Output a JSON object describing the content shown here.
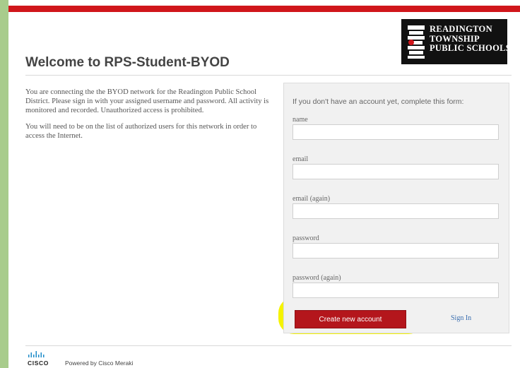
{
  "header": {
    "title": "Welcome to RPS-Student-BYOD",
    "logo_lines": [
      "READINGTON",
      "TOWNSHIP",
      "PUBLIC SCHOOLS"
    ]
  },
  "intro": {
    "paragraph1": "You are connecting the the BYOD network for the Readington Public School District. Please sign in with your assigned username and password. All activity is monitored and recorded. Unauthorized access is prohibited.",
    "paragraph2": "You will need to be on the list of authorized users for this network in order to access the Internet."
  },
  "form": {
    "heading": "If you don't have an account yet, complete this form:",
    "fields": [
      {
        "label": "name",
        "value": ""
      },
      {
        "label": "email",
        "value": ""
      },
      {
        "label": "email (again)",
        "value": ""
      },
      {
        "label": "password",
        "value": ""
      },
      {
        "label": "password (again)",
        "value": ""
      }
    ],
    "create_button": "Create new account",
    "signin_link": "Sign In"
  },
  "footer": {
    "brand": "CISCO",
    "powered_by": "Powered by Cisco Meraki"
  },
  "colors": {
    "top_bar": "#d0161b",
    "button": "#b4161c",
    "highlight": "#f5f300",
    "link": "#3b6fb0",
    "outer_background": "#a8cc8c"
  }
}
